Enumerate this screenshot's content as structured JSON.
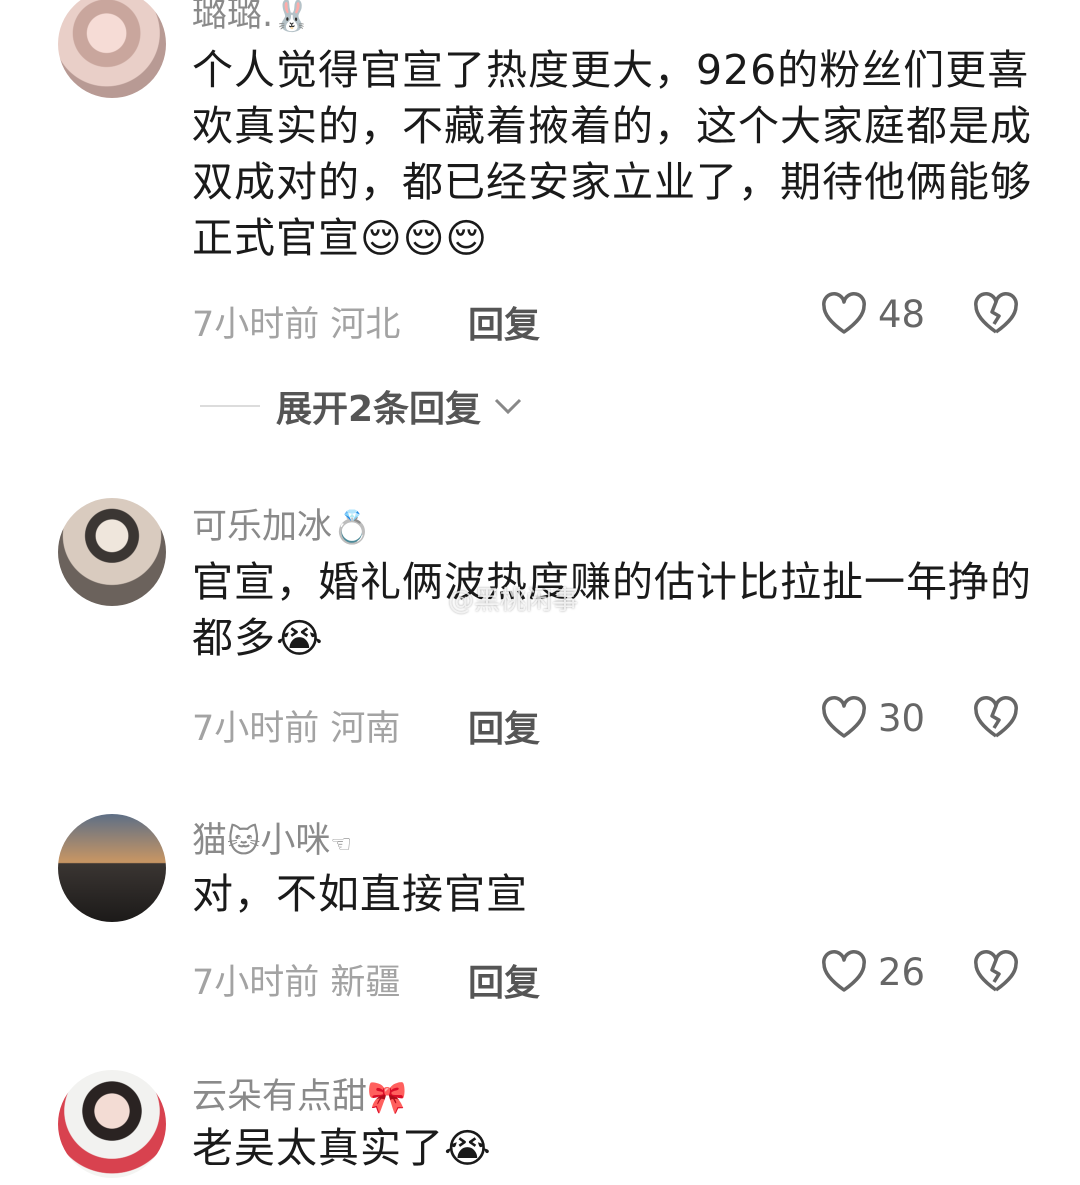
{
  "comments": [
    {
      "username": "璐璐.",
      "username_emoji": "🐰",
      "text": "个人觉得官宣了热度更大，926的粉丝们更喜欢真实的，不藏着掖着的，这个大家庭都是成双成对的，都已经安家立业了，期待他俩能够正式官宣",
      "text_emoji": "😌😌😌",
      "time": "7小时前",
      "location": "河北",
      "reply_label": "回复",
      "likes": "48",
      "expand_label": "展开2条回复"
    },
    {
      "username": "可乐加冰",
      "username_emoji": "💍",
      "text": "官宣，婚礼俩波热度赚的估计比拉扯一年挣的都多",
      "text_emoji": "😭",
      "time": "7小时前",
      "location": "河南",
      "reply_label": "回复",
      "likes": "30"
    },
    {
      "username": "猫",
      "username_emoji": "🐱",
      "username_suffix": "小咪",
      "username_suffix_emoji": "☜",
      "text": "对，不如直接官宣",
      "time": "7小时前",
      "location": "新疆",
      "reply_label": "回复",
      "likes": "26"
    },
    {
      "username": "云朵有点甜",
      "username_emoji": "🎀",
      "text": "老吴太真实了",
      "text_emoji": "😭"
    }
  ],
  "watermark": "@黑桃闲事",
  "icons": {
    "like": "heart-outline-icon",
    "dislike": "broken-heart-icon",
    "expand": "chevron-down-icon"
  }
}
